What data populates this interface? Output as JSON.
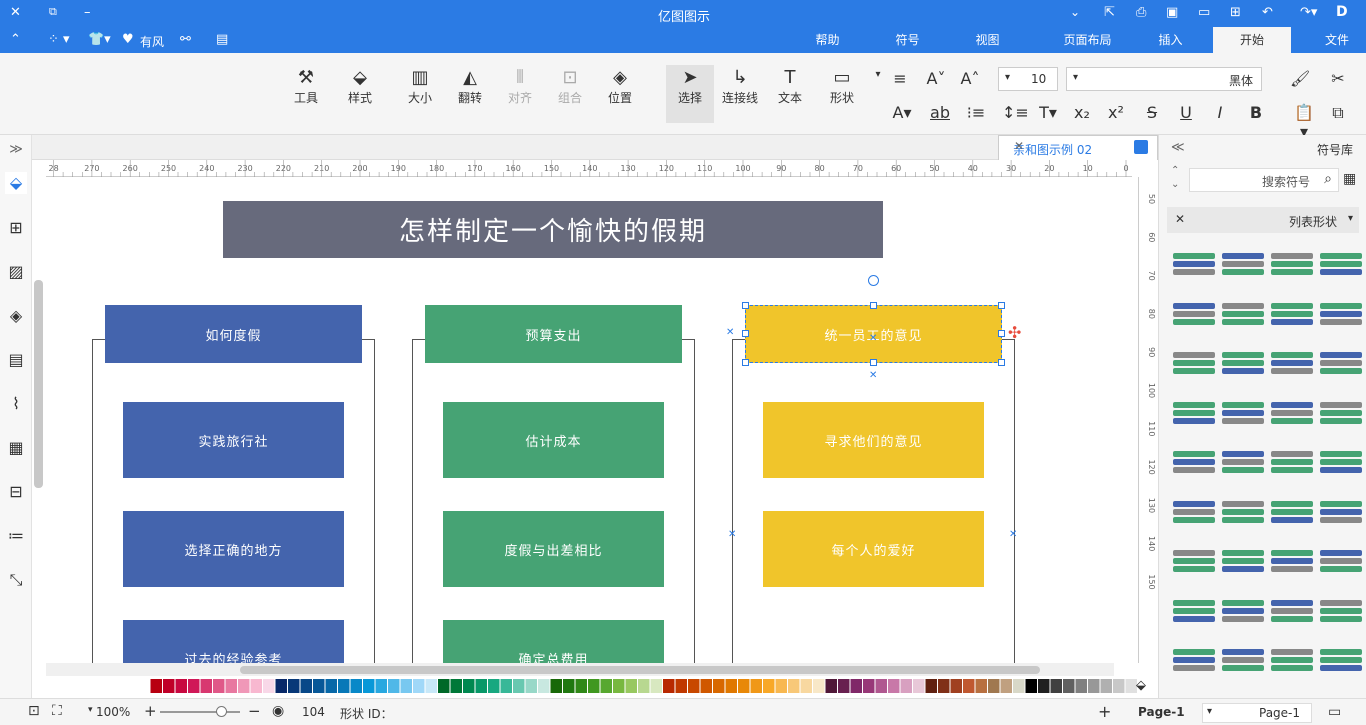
{
  "app": {
    "title": "亿图图示"
  },
  "menu": {
    "tabs": [
      "文件",
      "开始",
      "插入",
      "页面布局",
      "视图",
      "符号",
      "帮助"
    ],
    "active": "开始",
    "left_items": {
      "font_style": "有风"
    }
  },
  "ribbon": {
    "font_name": "黑体",
    "font_size": "10",
    "buttons": [
      "形状",
      "文本",
      "连接线",
      "选择",
      "位置",
      "组合",
      "对齐",
      "翻转",
      "大小",
      "样式",
      "工具"
    ]
  },
  "doc_tab": {
    "name": "亲和图示例 02"
  },
  "right_panel": {
    "title": "符号库",
    "search_placeholder": "搜索符号",
    "section": "列表形状"
  },
  "ruler_top": [
    "0",
    "10",
    "20",
    "30",
    "40",
    "50",
    "60",
    "70",
    "80",
    "90",
    "100",
    "110",
    "120",
    "130",
    "140",
    "150",
    "160",
    "170",
    "180",
    "190",
    "200",
    "210",
    "220",
    "230",
    "240",
    "250",
    "260",
    "270",
    "28"
  ],
  "ruler_right": [
    "50",
    "60",
    "70",
    "80",
    "90",
    "100",
    "110",
    "120",
    "130",
    "140",
    "150"
  ],
  "diagram": {
    "title": "怎样制定一个愉快的假期",
    "columns": [
      {
        "header": "如何度假",
        "items": [
          "实践旅行社",
          "选择正确的地方",
          "过去的经验参考"
        ]
      },
      {
        "header": "预算支出",
        "items": [
          "估计成本",
          "度假与出差相比",
          "确定总费用"
        ]
      },
      {
        "header": "统一员工的意见",
        "items": [
          "寻求他们的意见",
          "每个人的爱好"
        ]
      }
    ]
  },
  "colors": {
    "blue": "#4464ad",
    "green": "#46a374",
    "yellow": "#f0c52b",
    "title_bg": "#676a7c",
    "accent": "#2b7be4"
  },
  "status": {
    "page_selector": "Page-1",
    "page_tab": "Page-1",
    "shape_id_label": "形状 ID：",
    "shape_id": "104",
    "zoom": "100%"
  }
}
